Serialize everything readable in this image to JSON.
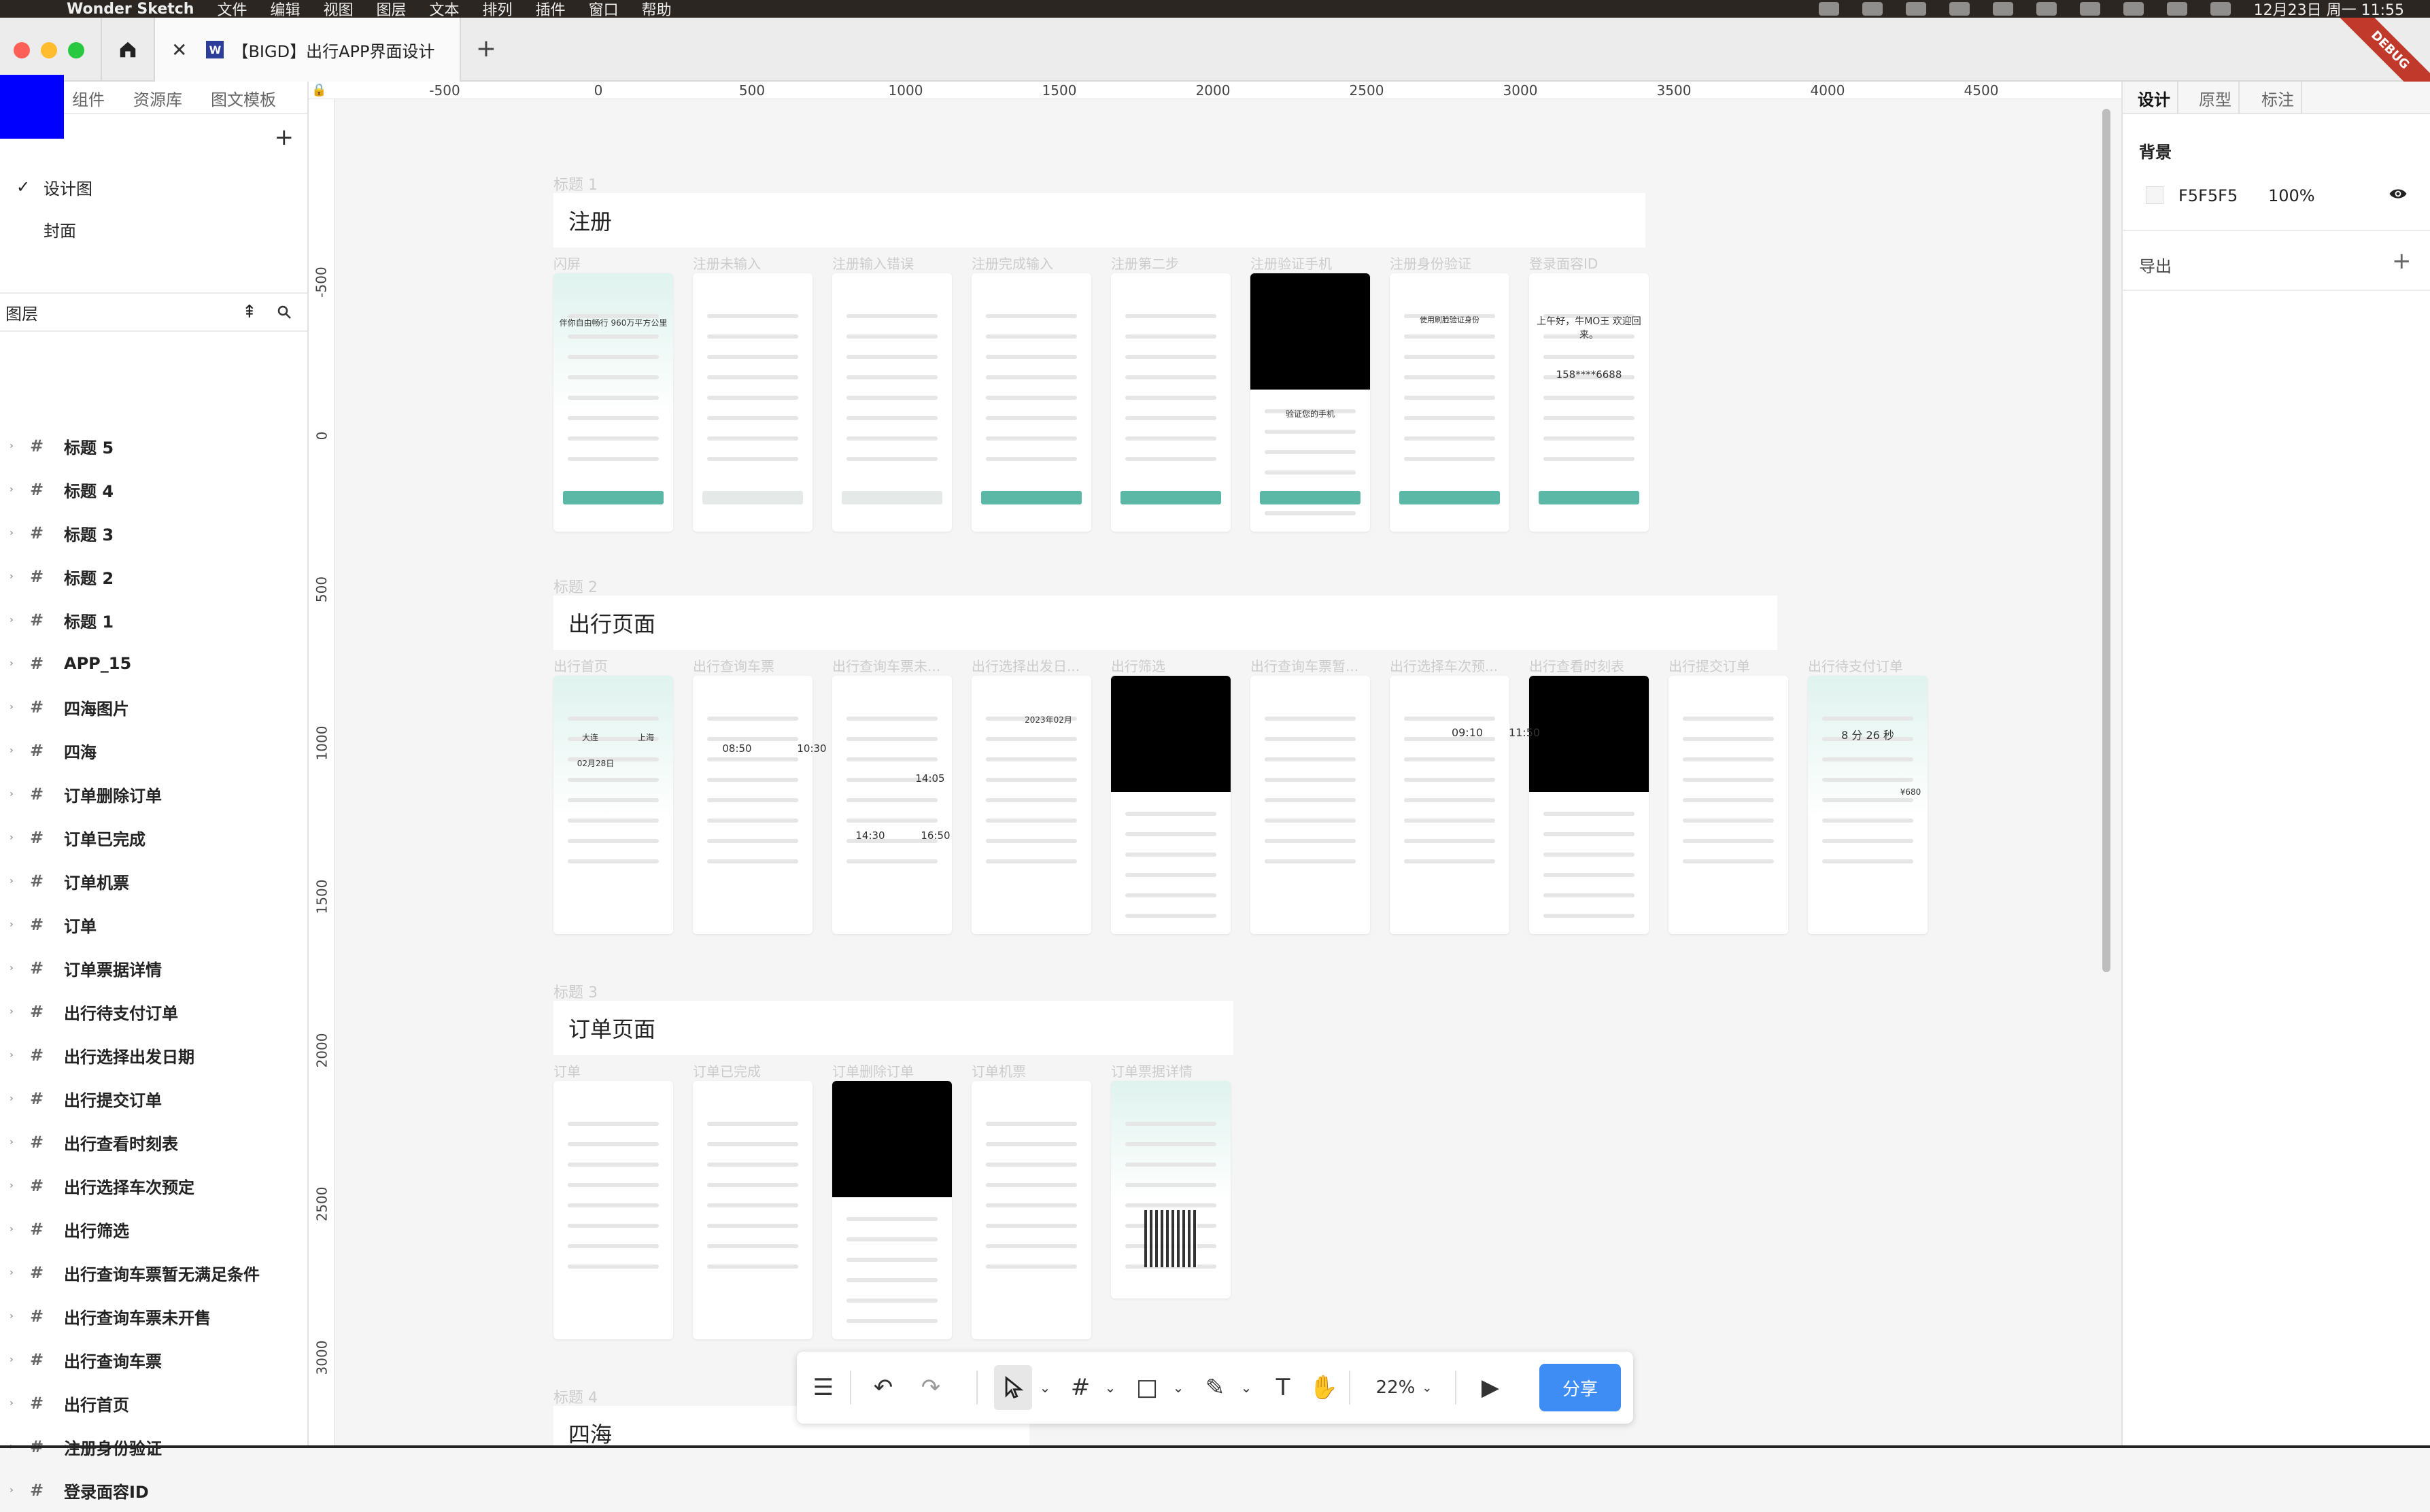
{
  "menubar": {
    "app_name": "Wonder Sketch",
    "items": [
      "文件",
      "编辑",
      "视图",
      "图层",
      "文本",
      "排列",
      "插件",
      "窗口",
      "帮助"
    ],
    "clock": "12月23日 周一 11:55"
  },
  "tabbar": {
    "doc_title": "【BIGD】出行APP界面设计",
    "doc_icon_letter": "W",
    "debug_ribbon": "DEBUG"
  },
  "left_panel": {
    "tabs": [
      "组件",
      "资源库",
      "图文模板"
    ],
    "pages": [
      {
        "label": "设计图",
        "selected": true
      },
      {
        "label": "封面",
        "selected": false
      }
    ],
    "layers_title": "图层",
    "layers": [
      "标题 5",
      "标题 4",
      "标题 3",
      "标题 2",
      "标题 1",
      "APP_15",
      "四海图片",
      "四海",
      "订单删除订单",
      "订单已完成",
      "订单机票",
      "订单",
      "订单票据详情",
      "出行待支付订单",
      "出行选择出发日期",
      "出行提交订单",
      "出行查看时刻表",
      "出行选择车次预定",
      "出行筛选",
      "出行查询车票暂无满足条件",
      "出行查询车票未开售",
      "出行查询车票",
      "出行首页",
      "注册身份验证",
      "登录面容ID"
    ]
  },
  "rulers": {
    "top": [
      "-500",
      "0",
      "500",
      "1000",
      "1500",
      "2000",
      "2500",
      "3000",
      "3500",
      "4000",
      "4500"
    ],
    "left": [
      "-500",
      "0",
      "500",
      "1000",
      "1500",
      "2000",
      "2500",
      "3000"
    ]
  },
  "canvas": {
    "sections": [
      {
        "small": "标题 1",
        "title": "注册",
        "screens": [
          "闪屏",
          "注册未输入",
          "注册输入错误",
          "注册完成输入",
          "注册第二步",
          "注册验证手机",
          "注册身份验证",
          "登录面容ID"
        ]
      },
      {
        "small": "标题 2",
        "title": "出行页面",
        "screens": [
          "出行首页",
          "出行查询车票",
          "出行查询车票未...",
          "出行选择出发日...",
          "出行筛选",
          "出行查询车票暂...",
          "出行选择车次预...",
          "出行查看时刻表",
          "出行提交订单",
          "出行待支付订单"
        ]
      },
      {
        "small": "标题 3",
        "title": "订单页面",
        "screens": [
          "订单",
          "订单已完成",
          "订单删除订单",
          "订单机票",
          "订单票据详情"
        ]
      },
      {
        "small": "标题 4",
        "title": "四海",
        "screens": []
      }
    ],
    "screen_texts": {
      "splash": "伴你自由畅行 960万平方公里",
      "welcome": "上午好，牛MO王 欢迎回来。",
      "masked_phone": "158****6688",
      "verify_phone": "验证您的手机",
      "identity": "使用刷脸验证身份",
      "city_from": "大连",
      "city_to": "上海",
      "date": "02月28日",
      "month": "2023年02月",
      "countdown": "8 分 26 秒",
      "time_a": "09:10",
      "time_b": "11:50",
      "time_c": "08:50",
      "time_d": "10:30",
      "time_e": "14:05",
      "time_f": "16:50",
      "time_g": "14:30",
      "price": "¥680"
    }
  },
  "right_panel": {
    "tabs": [
      "设计",
      "原型",
      "标注"
    ],
    "background_title": "背景",
    "background_hex": "F5F5F5",
    "background_opacity": "100%",
    "export_title": "导出"
  },
  "toolbar": {
    "zoom": "22%",
    "share_label": "分享"
  },
  "colors": {
    "accent_teal": "#5cb8a6",
    "share_blue": "#3d8df5",
    "canvas_bg": "#f5f5f5"
  }
}
